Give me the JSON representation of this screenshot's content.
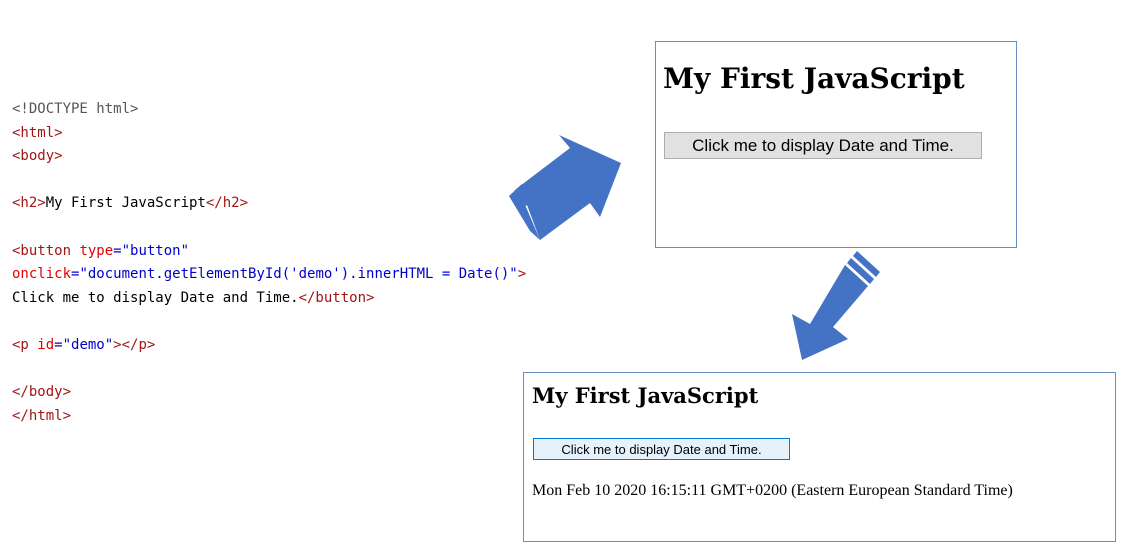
{
  "code_lines": [
    [
      {
        "t": "<!DOCTYPE html>",
        "c": "doc"
      }
    ],
    [
      {
        "t": "<html>",
        "c": "tag"
      }
    ],
    [
      {
        "t": "<body>",
        "c": "tag"
      }
    ],
    [],
    [
      {
        "t": "<h2>",
        "c": "tag"
      },
      {
        "t": "My First JavaScript",
        "c": "txt"
      },
      {
        "t": "</h2>",
        "c": "tag"
      }
    ],
    [],
    [
      {
        "t": "<button ",
        "c": "tag"
      },
      {
        "t": "type",
        "c": "attr"
      },
      {
        "t": "=\"button\"",
        "c": "val"
      }
    ],
    [
      {
        "t": "onclick",
        "c": "attr"
      },
      {
        "t": "=\"document.getElementById('demo').innerHTML = Date()\"",
        "c": "val"
      },
      {
        "t": ">",
        "c": "tag"
      }
    ],
    [
      {
        "t": "Click me to display Date and Time.",
        "c": "txt"
      },
      {
        "t": "</button>",
        "c": "tag"
      }
    ],
    [],
    [
      {
        "t": "<p ",
        "c": "tag"
      },
      {
        "t": "id",
        "c": "attr"
      },
      {
        "t": "=\"demo\"",
        "c": "val"
      },
      {
        "t": "></p>",
        "c": "tag"
      }
    ],
    [],
    [
      {
        "t": "</body>",
        "c": "tag"
      }
    ],
    [
      {
        "t": "</html>",
        "c": "tag"
      }
    ]
  ],
  "before": {
    "heading": "My First JavaScript",
    "button_label": "Click me to display Date and Time."
  },
  "after": {
    "heading": "My First JavaScript",
    "button_label": "Click me to display Date and Time.",
    "demo_text": "Mon Feb 10 2020 16:15:11 GMT+0200 (Eastern European Standard Time)"
  },
  "colors": {
    "arrow_fill": "#4472c4",
    "panel_border": "#6b8fc4"
  }
}
